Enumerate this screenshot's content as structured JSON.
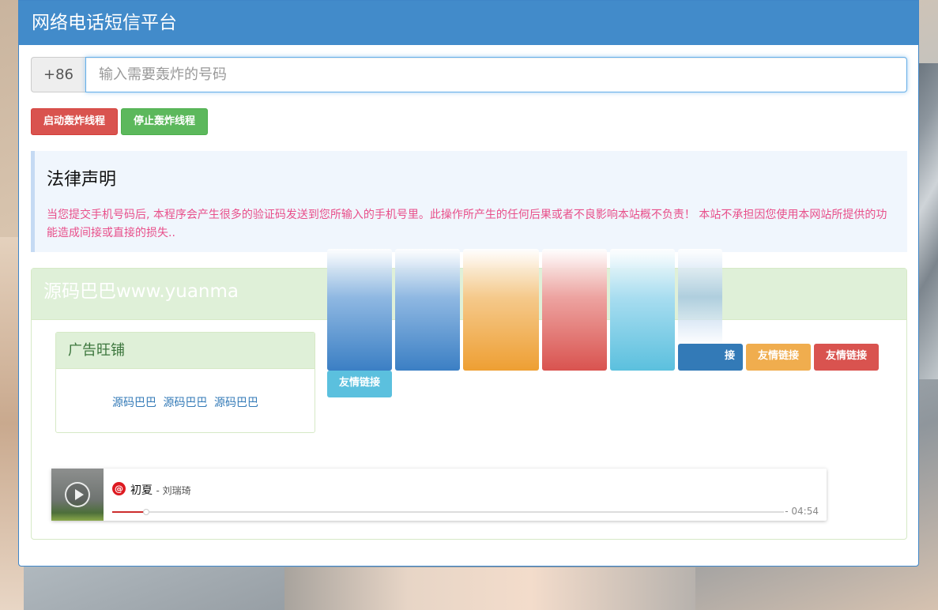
{
  "header": {
    "title": "网络电话短信平台"
  },
  "phone": {
    "prefix": "+86",
    "placeholder": "输入需要轰炸的号码",
    "value": ""
  },
  "buttons": {
    "start": "启动轰炸线程",
    "stop": "停止轰炸线程"
  },
  "notice": {
    "title": "法律声明",
    "text": "当您提交手机号码后, 本程序会产生很多的验证码发送到您所输入的手机号里。此操作所产生的任何后果或者不良影响本站概不负责！ 本站不承担因您使用本网站所提供的功能造成间接或直接的损失.."
  },
  "box": {
    "heading": "源码巴巴www.yuanma"
  },
  "ad": {
    "title": "广告旺铺",
    "links": [
      "源码巴巴",
      "源码巴巴",
      "源码巴巴"
    ]
  },
  "friend_links": {
    "partial_label": "接",
    "labels": [
      "友情链接",
      "友情链接",
      "友情链接"
    ]
  },
  "player": {
    "song": "初夏",
    "artist": "- 刘瑞琦",
    "time": "- 04:54",
    "progress": 0.05
  },
  "colors": {
    "primary": "#428bca",
    "danger": "#d9534f",
    "success": "#5cb85c",
    "warning": "#f0ad4e",
    "info": "#5bc0de"
  }
}
